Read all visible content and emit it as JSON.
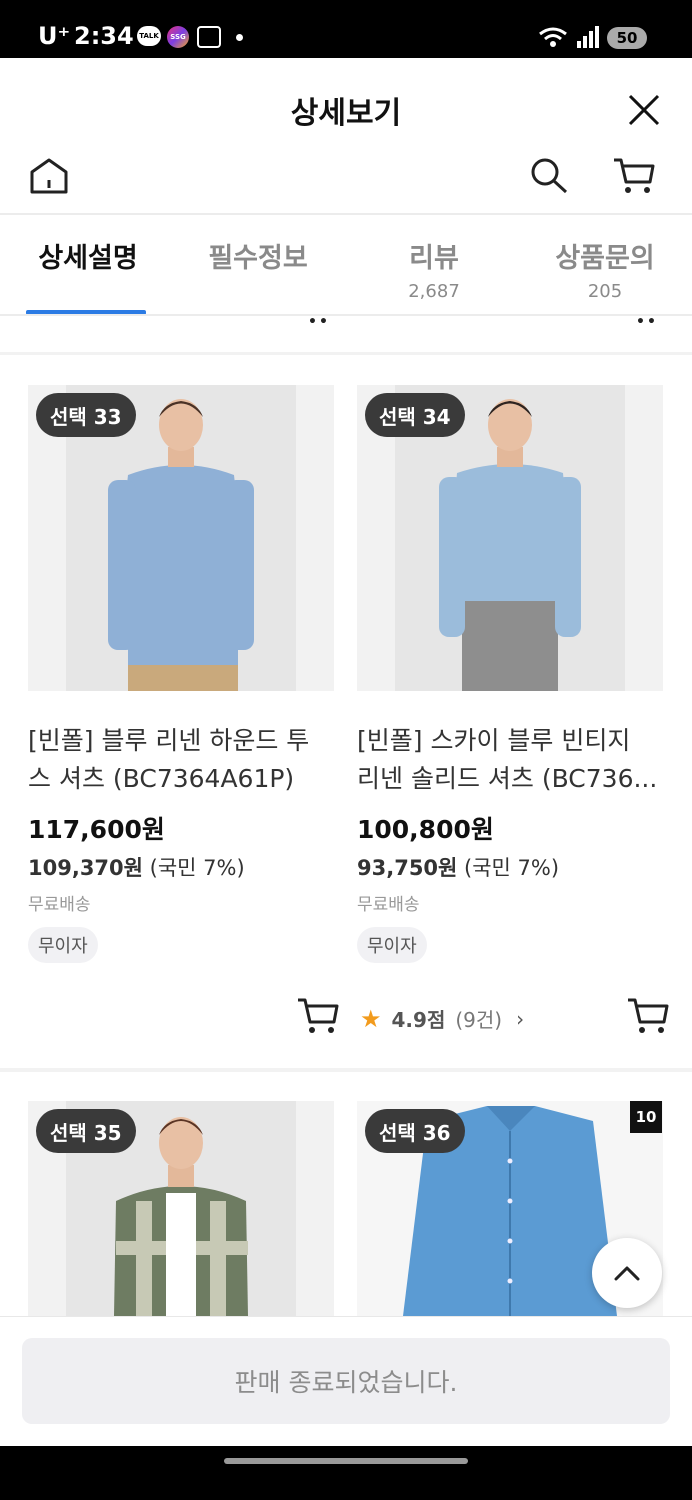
{
  "status_bar": {
    "carrier": "U⁺",
    "time": "2:34",
    "talk": "TALK",
    "ssg": "SSG",
    "battery": "50"
  },
  "header": {
    "title": "상세보기"
  },
  "tabs": [
    {
      "label": "상세설명",
      "count": ""
    },
    {
      "label": "필수정보",
      "count": ""
    },
    {
      "label": "리뷰",
      "count": "2,687"
    },
    {
      "label": "상품문의",
      "count": "205"
    }
  ],
  "products": [
    {
      "badge": "선택 33",
      "name_line1": "[빈폴] 블루 리넨 하운드 투",
      "name_line2": "스 셔츠 (BC7364A61P)",
      "price": "117,600원",
      "sub_price_value": "109,370원",
      "sub_price_note": " (국민 7%)",
      "shipping": "무료배송",
      "tag": "무이자"
    },
    {
      "badge": "선택 34",
      "name_line1": "[빈폴] 스카이 블루 빈티지",
      "name_line2": "리넨 솔리드 셔츠 (BC736...",
      "price": "100,800원",
      "sub_price_value": "93,750원",
      "sub_price_note": " (국민 7%)",
      "shipping": "무료배송",
      "tag": "무이자",
      "rating": {
        "star": "★",
        "score": "4.9점",
        "count": "(9건)",
        "arrow": "›"
      }
    },
    {
      "badge": "선택 35"
    },
    {
      "badge": "선택 36",
      "corner_badge": "10"
    }
  ],
  "footer": {
    "soldout_label": "판매 종료되었습니다."
  },
  "icons": {
    "home": "home-icon",
    "search": "search-icon",
    "cart": "cart-icon",
    "close": "close-icon",
    "scroll_top": "chevron-up-icon"
  },
  "colors": {
    "accent": "#2b7be4",
    "star": "#f29b1d"
  }
}
